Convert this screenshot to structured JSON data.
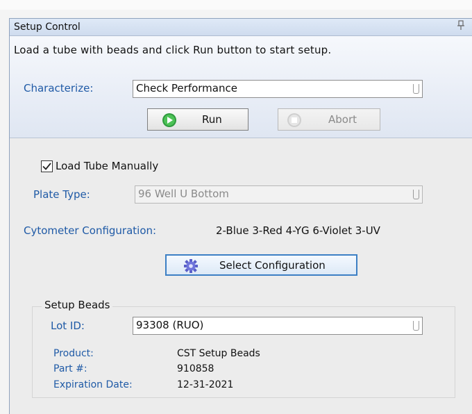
{
  "panel": {
    "title": "Setup Control",
    "instruction": "Load a tube with beads and click Run button to start setup."
  },
  "characterize": {
    "label": "Characterize:",
    "value": "Check Performance"
  },
  "buttons": {
    "run_label": "Run",
    "abort_label": "Abort",
    "select_config_label": "Select Configuration"
  },
  "load_tube": {
    "label": "Load Tube Manually",
    "checked": true
  },
  "plate_type": {
    "label": "Plate Type:",
    "value": "96 Well U Bottom"
  },
  "cytometer": {
    "label": "Cytometer Configuration:",
    "value": "2-Blue 3-Red 4-YG 6-Violet 3-UV"
  },
  "setup_beads": {
    "group_title": "Setup Beads",
    "lot_label": "Lot ID:",
    "lot_value": "93308 (RUO)",
    "product_label": "Product:",
    "product_value": "CST Setup Beads",
    "part_label": "Part #:",
    "part_value": "910858",
    "expiration_label": "Expiration Date:",
    "expiration_value": "12-31-2021"
  },
  "icons": {
    "run": "run-play-icon",
    "abort": "abort-stop-icon",
    "config": "gear-config-icon",
    "pin": "pin-icon"
  },
  "colors": {
    "label_blue": "#1f5aa6",
    "title_gradient_top": "#dfe9f7",
    "focus_border": "#3c7fc4"
  }
}
